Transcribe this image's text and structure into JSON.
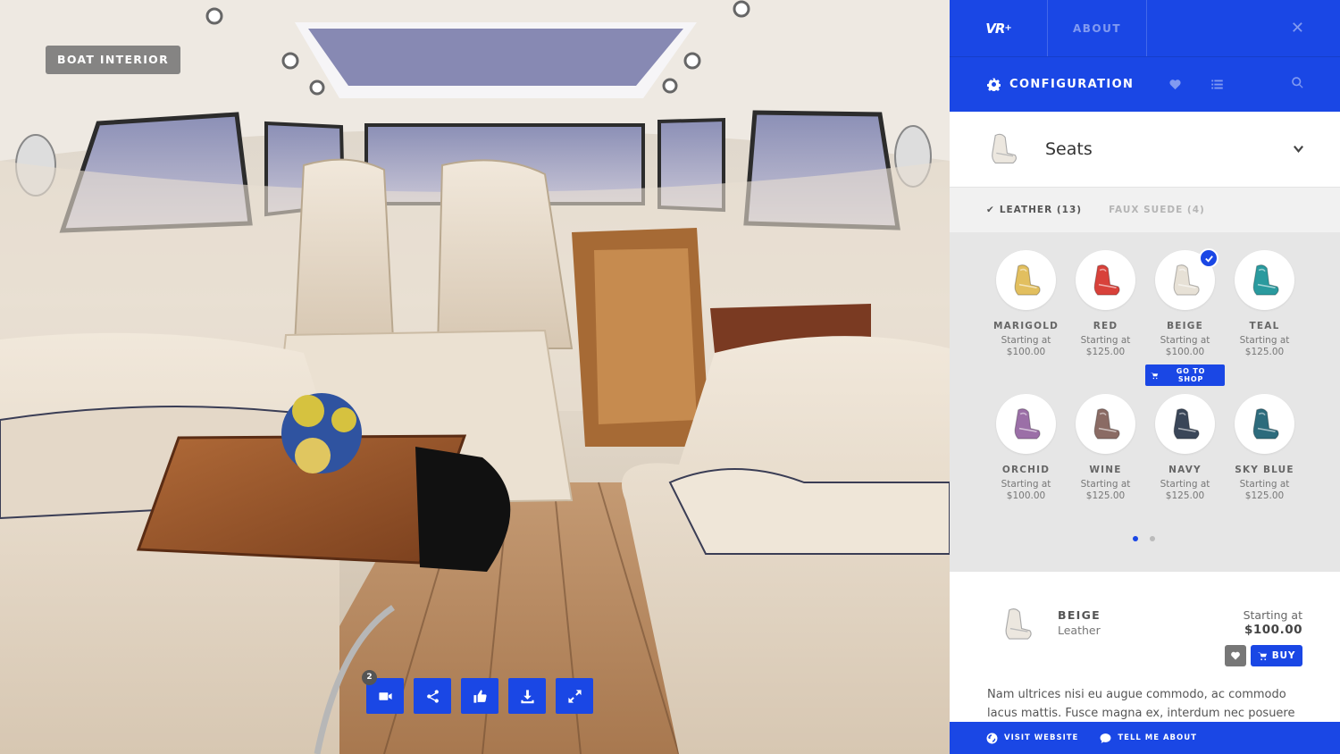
{
  "viewer": {
    "scene_label": "BOAT INTERIOR",
    "tools": [
      {
        "icon": "video-camera-icon",
        "badge": "2"
      },
      {
        "icon": "share-icon"
      },
      {
        "icon": "thumbs-up-icon"
      },
      {
        "icon": "download-icon"
      },
      {
        "icon": "expand-icon"
      }
    ]
  },
  "panel": {
    "logo": "VR",
    "logo_sup": "+",
    "about_label": "ABOUT",
    "close_icon": "close-icon",
    "config_title": "CONFIGURATION",
    "section_title": "Seats",
    "tabs": [
      {
        "label": "LEATHER (13)",
        "active": true
      },
      {
        "label": "FAUX SUEDE (4)",
        "active": false
      }
    ],
    "items": [
      {
        "name": "MARIGOLD",
        "price_line1": "Starting at",
        "price_line2": "$100.00",
        "color": "#e2bf5f"
      },
      {
        "name": "RED",
        "price_line1": "Starting at",
        "price_line2": "$125.00",
        "color": "#d8413a"
      },
      {
        "name": "BEIGE",
        "price_line1": "Starting at",
        "price_line2": "$100.00",
        "color": "#e7e1d6",
        "selected": true,
        "shop_label": "GO TO SHOP"
      },
      {
        "name": "TEAL",
        "price_line1": "Starting at",
        "price_line2": "$125.00",
        "color": "#2a9a9e"
      },
      {
        "name": "ORCHID",
        "price_line1": "Starting at",
        "price_line2": "$100.00",
        "color": "#9b6fa7"
      },
      {
        "name": "WINE",
        "price_line1": "Starting at",
        "price_line2": "$125.00",
        "color": "#8a6b64"
      },
      {
        "name": "NAVY",
        "price_line1": "Starting at",
        "price_line2": "$125.00",
        "color": "#3a4658"
      },
      {
        "name": "SKY BLUE",
        "price_line1": "Starting at",
        "price_line2": "$125.00",
        "color": "#2d6b7c"
      }
    ],
    "page_count": 2,
    "current_page": 1,
    "detail": {
      "name": "BEIGE",
      "material": "Leather",
      "starting_label": "Starting at",
      "price": "$100.00",
      "buy_label": "BUY",
      "description": "Nam ultrices nisi eu augue commodo, ac commodo lacus mattis. Fusce magna ex, interdum nec posuere"
    },
    "footer": {
      "website_label": "VISIT WEBSITE",
      "tell_label": "TELL ME ABOUT"
    }
  },
  "colors": {
    "accent": "#1a47e5"
  }
}
